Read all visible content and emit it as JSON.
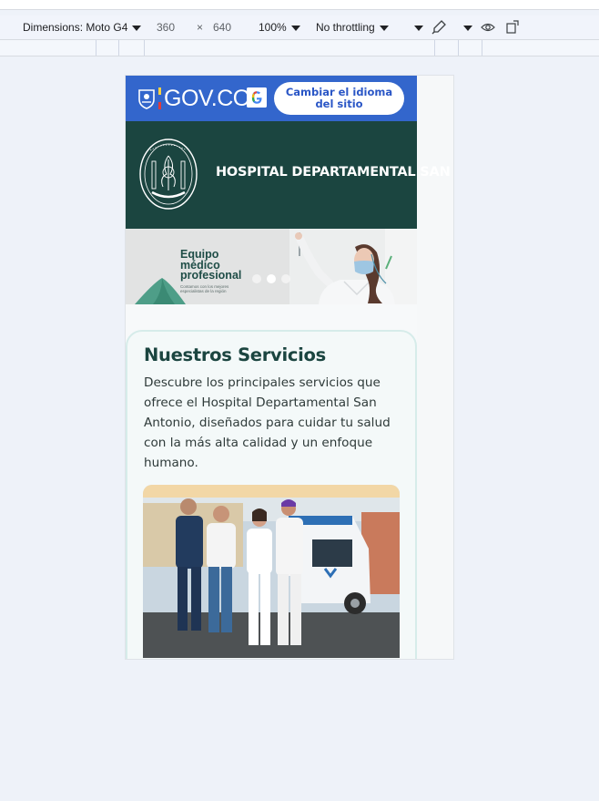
{
  "devtools": {
    "dimensions_label": "Dimensions: Moto G4",
    "width": "360",
    "times": "×",
    "height": "640",
    "zoom": "100%",
    "throttling": "No throttling"
  },
  "site": {
    "gov_logo_text": "GOV.CO",
    "language_button": "Cambiar el idioma del sitio",
    "hospital_name": "HOSPITAL DEPARTAMENTAL SAN A",
    "banner": {
      "title_line1": "Equipo",
      "title_line2": "médico",
      "title_line3": "profesional",
      "subtitle": "Contamos con los mejores especialistas de la región",
      "slides": 3,
      "active_slide": 2
    },
    "services": {
      "title": "Nuestros Servicios",
      "description": "Descubre los principales servicios que ofrece el Hospital Departamental San Antonio, diseñados para cuidar tu salud con la más alta calidad y un enfoque humano."
    }
  },
  "colors": {
    "gov_blue": "#3366cc",
    "hospital_green": "#1b4540",
    "card_border": "#d6ecea",
    "page_bg": "#eef2f9"
  }
}
